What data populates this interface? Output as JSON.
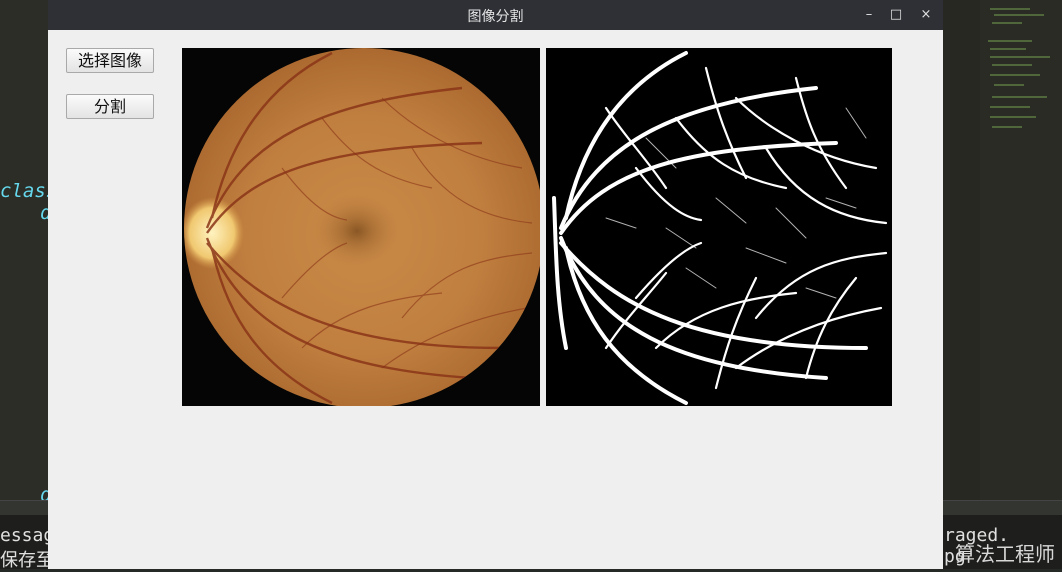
{
  "window": {
    "title": "图像分割",
    "controls": {
      "minimize": "–",
      "maximize": "□",
      "close": "×"
    }
  },
  "sidebar": {
    "select_image_label": "选择图像",
    "segment_label": "分割"
  },
  "images": {
    "original": "retina-fundus-photo",
    "segmented": "vessel-segmentation-mask"
  },
  "background_ide": {
    "code_keyword": "class",
    "code_fragment": "d",
    "console_line1": "essag",
    "console_line2": "保存至",
    "console_line3": "raged.",
    "console_line4": "pg",
    "watermark": "算法工程师"
  }
}
